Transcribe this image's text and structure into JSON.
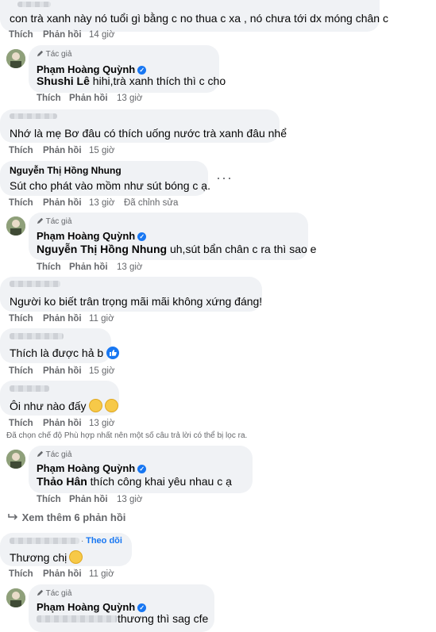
{
  "actions": {
    "like": "Thích",
    "reply": "Phản hồi",
    "edited": "Đã chỉnh sửa"
  },
  "author_badge": "Tác giả",
  "author_name": "Phạm Hoàng Quỳnh",
  "comments": [
    {
      "text": "con trà xanh này nó tuổi gì bằng c no thua c xa , nó chưa tới dx móng chân c",
      "time": "14 giờ"
    },
    {
      "mention": "Shushi Lê",
      "text": " hihi,trà xanh thích thì c cho",
      "time": "13 giờ"
    },
    {
      "text": "Nhớ là mẹ Bơ đâu có thích uống nước trà xanh đâu nhể",
      "time": "15 giờ"
    },
    {
      "name": "Nguyễn Thị Hồng Nhung",
      "text": "Sút cho phát vào mồm như sút bóng c ạ.",
      "time": "13 giờ"
    },
    {
      "mention": "Nguyễn Thị Hồng Nhung",
      "text": " uh,sút bẩn chân c ra thì sao e",
      "time": "13 giờ"
    },
    {
      "text": "Người ko biết trân trọng mãi mãi không xứng đáng!",
      "time": "11 giờ"
    },
    {
      "text": "Thích là được hả b",
      "time": "15 giờ"
    },
    {
      "text": "Ôi như nào đấy",
      "time": "13 giờ"
    },
    {
      "mention": "Thảo Hân",
      "text": " thích công khai yêu nhau c ạ",
      "time": "13 giờ"
    },
    {
      "text": "Thương chị",
      "time": "11 giờ",
      "follow": "Theo dõi"
    },
    {
      "text": " thương thì sag cfe"
    }
  ],
  "filter_note": "Đã chọn chế độ Phù hợp nhất nên một số câu trả lời có thể bị lọc ra.",
  "see_more": "Xem thêm 6 phản hồi",
  "more_dots": "···",
  "colors": {
    "bubble": "#f0f2f5",
    "meta": "#65676b",
    "accent": "#1877f2"
  }
}
